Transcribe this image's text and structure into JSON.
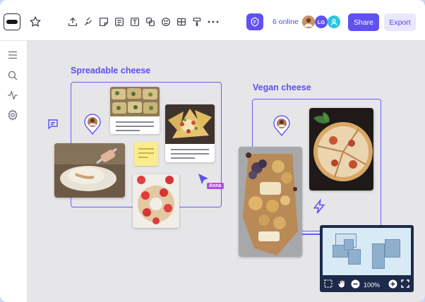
{
  "toolbar": {
    "online_text": "6 online",
    "share_label": "Share",
    "export_label": "Export",
    "avatar_initials": "LG"
  },
  "canvas": {
    "section1_title": "Spreadable cheese",
    "section2_title": "Vegan cheese",
    "cursor_user": "Anna"
  },
  "minimap": {
    "zoom": "100%"
  },
  "colors": {
    "accent": "#5f51f2",
    "canvas_bg": "#e6e6e9",
    "cursor": "#b14de0"
  }
}
